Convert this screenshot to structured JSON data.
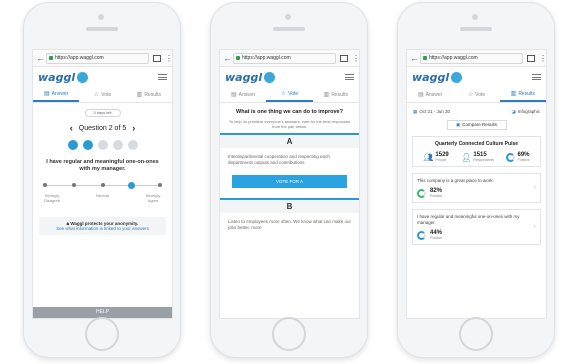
{
  "browser": {
    "url": "https://app.waggl.com"
  },
  "brand": {
    "logo_text": "waggl"
  },
  "tabs": {
    "answer": "Answer",
    "vote": "Vote",
    "results": "Results"
  },
  "answer_screen": {
    "days_left": "3 days left",
    "question_counter": "Question 2 of 5",
    "progress_total": 5,
    "progress_done": 2,
    "question": "I have regular and meaningful one-on-ones with my manager.",
    "scale_points": 5,
    "scale_selected_index": 3,
    "scale_labels": [
      "Strongly Disagree",
      "Neutral",
      "Strongly Agree"
    ],
    "anon_title": "Waggl protects your anonymity.",
    "anon_link": "See what information is linked to your answers",
    "help": "HELP"
  },
  "vote_screen": {
    "heading": "What is one thing we can do to improve?",
    "sub": "To help us prioritize everyone's answers, vote for the best responses from the pair below.",
    "option_a_label": "A",
    "option_a_text": "Interdepartmental cooperation and respecting each departments outputs and contributions",
    "vote_a_button": "VOTE FOR A",
    "option_b_label": "B",
    "option_b_text": "Listen to employees more often. We know what can make our jobs better, more"
  },
  "results_screen": {
    "date_range": "Oct 21 - Jun 30",
    "infographic": "Infographic",
    "compare": "Compare Results",
    "pulse_title": "Quarterly Connected Culture Pulse",
    "people_num": "1529",
    "people_lbl": "People",
    "respondents_num": "1515",
    "respondents_lbl": "Respondents",
    "positive_pct": "69%",
    "positive_lbl": "Positive",
    "card1_text": "This company is a great place to work.",
    "card1_pct": "82%",
    "card1_lbl": "Positive",
    "card2_text": "I have regular and meaningful one-on-ones with my manager.",
    "card2_pct": "44%",
    "card2_lbl": "Positive"
  },
  "colors": {
    "accent": "#2a9ad6",
    "brand": "#2a6fa8",
    "positive": "#3fb86b"
  }
}
